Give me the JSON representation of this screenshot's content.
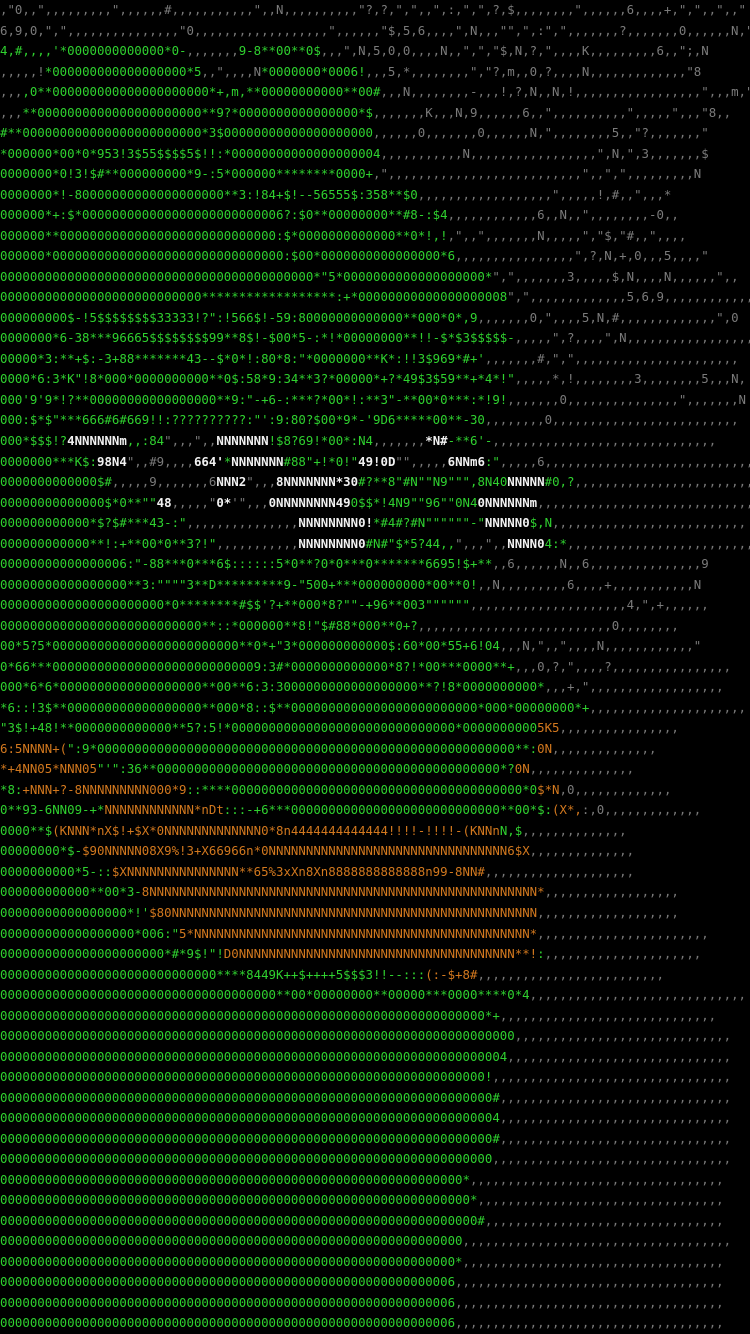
{
  "colors": {
    "background": "#000000",
    "green": "#2fd12f",
    "green_dim": "#1f8f1f",
    "gray": "#7a7a7a",
    "white": "#f2f2f2",
    "orange": "#d2781e"
  },
  "art": {
    "description_free": true,
    "lines": [
      [
        [
          "gr",
          ",\"0,,\",,,,,,,,,\",,,,,,#,,,,,,,,,,,\",,N,,,,,,,,,,\"?,?,\",\",,\",:,\",\",?,$,,,,,,,,\",,,,,,6,,,,+,\",\",,\",,\""
        ]
      ],
      [
        [
          "gr",
          "6,9,0,\",\",,,,,,,,,,,,,,,\"0,,,,,,,,,,,,,,,,,,\",,,,,,\"$,5,6,,,,\",N,,,\"\",\",:\",\",,,,,,,?,,,,,,,0,,,,,,N,\",\",\"5,,,"
        ]
      ],
      [
        [
          "g",
          "4,#,,,,"
        ],
        [
          "g",
          "'*0000000000000*0-"
        ],
        [
          "gr",
          ",,,,,,,"
        ],
        [
          "g",
          "9-8**00**0$"
        ],
        [
          "gr",
          ",,,\",N,5,0,0,,,,N,,\",\",\"$,N,?,\",,,,K,,,,,,,,,6,,\";,N"
        ]
      ],
      [
        [
          "gr",
          ",,,,,!"
        ],
        [
          "g",
          "*000000000000000000*5"
        ],
        [
          "gr",
          ",,\",,,,N"
        ],
        [
          "g",
          "*0000000*0006!"
        ],
        [
          "gr",
          ",,,5,*,,,,,,,,\",\"?,m,,0,?,,,,N,,,,,,,,,,,,,\"8"
        ]
      ],
      [
        [
          "gr",
          ",,,"
        ],
        [
          "g",
          ",0**000000000000000000000*+,m,**00000000000**00#"
        ],
        [
          "gr",
          ",,,N,,,,,,,,-,,,!,?,N,,N,!,,,,,,,,,,,,,,,,,\",,,m,\",N"
        ]
      ],
      [
        [
          "gr",
          ",,,"
        ],
        [
          "g",
          "**0000000000000000000000**9?*0000000000000000*$"
        ],
        [
          "gr",
          ",,,,,,,K,,,N,9,,,,,,6,,\",,,,,,,,,,\",,,,,\",,,\"8,,"
        ]
      ],
      [
        [
          "g",
          "#**000000000000000000000000*3$00000000000000000000"
        ],
        [
          "gr",
          ",,,,,,0,,,,,,,0,,,,,,N,\",,,,,,,,5,,\"?,,,,,,,\""
        ]
      ],
      [
        [
          "g",
          "*000000*00*0*953!3$55$$$$5$!!:*00000000000000000004"
        ],
        [
          "gr",
          ",,,,,,,,,,,N,,,,,,,,,,,,,,,,,\",N,\",3,,,,,,,$"
        ]
      ],
      [
        [
          "g",
          "0000000*0!3!$#**000000000*9-:5*000000********0000+"
        ],
        [
          "gr",
          ",\",,,,,,,,,,,,,,,,,,,,,,,,,,\",,\",\",,,,,,,,,N"
        ]
      ],
      [
        [
          "g",
          "0000000*!-80000000000000000000**3:!84+$!--56555$:358**$0"
        ],
        [
          "gr",
          ",,,,,,,,,,,,,,,,,,\",,,,,!,#,,\",,,*"
        ]
      ],
      [
        [
          "g",
          "000000*+:$*000000000000000000000000006?:$0**00000000**#8-:$4"
        ],
        [
          "gr",
          ",,,,,,,,,,,,6,,N,,\",,,,,,,,-0,,"
        ]
      ],
      [
        [
          "g",
          "000000**00000000000000000000000000000:$*0000000000000**0*!,!"
        ],
        [
          "gr",
          ",\",,\",,,,,,,N,,,,,\",\"$,\"#,,\",,,,"
        ]
      ],
      [
        [
          "g",
          "000000*0000000000000000000000000000000:$00*0000000000000000*6"
        ],
        [
          "gr",
          ",,,,,,,,,,,,,,,,\",?,N,+,0,,,5,,,,\""
        ]
      ],
      [
        [
          "g",
          "000000000000000000000000000000000000000000*\"5*0000000000000000000*"
        ],
        [
          "gr",
          "\",\",,,,,,,3,,,,,$,N,,,,N,,,,,,\",,"
        ]
      ],
      [
        [
          "g",
          "000000000000000000000000000******************:+*00000000000000000008"
        ],
        [
          "gr",
          "\",\",,,,,,,,,,,,,5,6,9,,,,,,,,,,,,"
        ]
      ],
      [
        [
          "g",
          "000000000$-!5$$$$$$$$33333!?\":!566$!-59:80000000000000**000*0*,9"
        ],
        [
          "gr",
          ",,,,,,,0,\",,,,5,N,#,,,,,,,,,,,,,\",0"
        ]
      ],
      [
        [
          "g",
          "0000000*6-38***96665$$$$$$$$99**8$!-$00*5-:*!*00000000**!!-$*$3$$$$$-"
        ],
        [
          "gr",
          ",,,,,\",?,,,,\",N,,,,,,,,,,,,,,,,,,"
        ]
      ],
      [
        [
          "g",
          "00000*3:**+$:-3+88*******43--$*0*!:80*8:\"*0000000**K*:!!3$969*#+'"
        ],
        [
          "gr",
          ",,,,,,,#,\",\",,,,,,,,,,,,,,,,,,,,,,"
        ]
      ],
      [
        [
          "g",
          "0000*6:3*K\"!8*000*0000000000**0$:58*9:34**3?*00000*+?*49$3$59**+*4*!\""
        ],
        [
          "gr",
          ",,,,,*,!,,,,,,,,3,,,,,,,,5,,,N,"
        ]
      ],
      [
        [
          "g",
          "000'9'9*!?**00000000000000000**9:\"-+6-:***?*00*!:**3\"-**00*0***:*!9!"
        ],
        [
          "gr",
          ",,,,,,,0,,,,,,,,,,,,,,,\",,,,,,,N"
        ]
      ],
      [
        [
          "g",
          "000:$*$\"***666#6#669!!:??????????:\"':9:80?$00*9*-'9D6*****00**-30"
        ],
        [
          "gr",
          ",,,,,,,,0,,,,,,,,,,,,,,,,,,,,,,,,,"
        ]
      ],
      [
        [
          "g",
          "000*$$$!?"
        ],
        [
          "w",
          "4NNNNNNm"
        ],
        [
          "g",
          ",,:84"
        ],
        [
          "gr",
          "\",,,\",,"
        ],
        [
          "w",
          "NNNNNNN"
        ],
        [
          "g",
          "!$8?69!*00*:N4"
        ],
        [
          "gr",
          ",,,,,,,"
        ],
        [
          "w",
          "*N#"
        ],
        [
          "g",
          "-**6'-"
        ],
        [
          "gr",
          ",,,,,,,,,,,,,,,,,,,,,,,,,,,,,,"
        ]
      ],
      [
        [
          "g",
          "0000000***K$:"
        ],
        [
          "w",
          "98N4"
        ],
        [
          "gr",
          "\",,#9,,,,"
        ],
        [
          "w",
          "664'"
        ],
        [
          "g",
          "*"
        ],
        [
          "w",
          "NNNNNNN"
        ],
        [
          "g",
          "#88\"+!*0!\""
        ],
        [
          "w",
          "49!0D"
        ],
        [
          "gr",
          "\"\",,,,,"
        ],
        [
          "w",
          "6NNm6"
        ],
        [
          "g",
          ":\""
        ],
        [
          "gr",
          ",,,,,6,,,,,,,,,,,,,,,,,,,,,,,,,,,,"
        ]
      ],
      [
        [
          "g",
          "0000000000000$#"
        ],
        [
          "gr",
          ",,,,,9,,,,,,,6"
        ],
        [
          "w",
          "NNN2"
        ],
        [
          "gr",
          "\",,,"
        ],
        [
          "w",
          "8NNNNNNN*30"
        ],
        [
          "g",
          "#?**8\"#N\"\"N9\"\"\",8N40"
        ],
        [
          "w",
          "NNNNN"
        ],
        [
          "g",
          "#0,?"
        ],
        [
          "gr",
          ",,,,,,,,,,,,,,,,,,,,,,,,"
        ]
      ],
      [
        [
          "g",
          "00000000000000$*0**\"\""
        ],
        [
          "w",
          "48"
        ],
        [
          "gr",
          ",,,,,\""
        ],
        [
          "w",
          "0*"
        ],
        [
          "gr",
          "'\",,,"
        ],
        [
          "w",
          "0NNNNNNNN49"
        ],
        [
          "g",
          "0$$*!4N9\"\"96\"\"0N4"
        ],
        [
          "w",
          "0NNNNNNm"
        ],
        [
          "gr",
          ",,,,,,,,,,,,,,,,,,,,,,,,,,,,,,,,"
        ]
      ],
      [
        [
          "g",
          "000000000000*$?$#***43-:\""
        ],
        [
          "gr",
          ",,,,,,,,,,,,,,,"
        ],
        [
          "w",
          "NNNNNNNN0!"
        ],
        [
          "g",
          "*#4#?#N\"\"\"\"\"\"-\""
        ],
        [
          "w",
          "NNNNN0"
        ],
        [
          "g",
          "$,N"
        ],
        [
          "gr",
          ",,,,,,,,,,,,,,,,,,,,,,,,,,"
        ]
      ],
      [
        [
          "g",
          "000000000000**!:+**00*0**3?!\""
        ],
        [
          "gr",
          ",,,,,,,,,,,"
        ],
        [
          "w",
          "NNNNNNNN0"
        ],
        [
          "g",
          "#N#\"$*5?44,,"
        ],
        [
          "gr",
          "\",,,\",,"
        ],
        [
          "w",
          "NNNN0"
        ],
        [
          "g",
          "4:*"
        ],
        [
          "gr",
          ",,,,,,,,,,,,,,,,,,,,,,,,,,,,"
        ]
      ],
      [
        [
          "g",
          "00000000000000006:\"-88***0***6$::::::5*0**?0*0***0*******6695!$+**"
        ],
        [
          "gr",
          ",,6,,,,,,N,,6,,,,,,,,,,,,,,,9"
        ]
      ],
      [
        [
          "g",
          "00000000000000000**3:\"\"\"\"3**D*********9-\"500+***000000000*00**0!"
        ],
        [
          "gr",
          ",,N,,,,,,,,,6,,,,+,,,,,,,,,,,N"
        ]
      ],
      [
        [
          "g",
          "0000000000000000000000*0********#$$'?+**000*8?\"\"-+96**003\"\"\"\"\"\""
        ],
        [
          "gr",
          ",,,,,,,,,,,,,,,,,,,,,4,\",+,,,,,,"
        ]
      ],
      [
        [
          "g",
          "000000000000000000000000000**::*000000**8!\"$#88*000**0+?"
        ],
        [
          "gr",
          ",,,,,,,,,,,,,,,,,,,,,,,,,,0,,,,,,,,"
        ]
      ],
      [
        [
          "g",
          "00*5?5*0000000000000000000000000**0*+\"3*000000000000$:60*00*55+6!04"
        ],
        [
          "gr",
          ",,,N,\",,\",,,,N,,,,,,,,,,,,\""
        ]
      ],
      [
        [
          "g",
          "0*66***0000000000000000000000000009:3#*0000000000000*8?!*00***0000**+"
        ],
        [
          "gr",
          ",,,0,?,\",,,,?,,,,,,,,,,,,,,,,"
        ]
      ],
      [
        [
          "g",
          "000*6*6*0000000000000000000**00**6:3:3000000000000000000**?!8*0000000000*"
        ],
        [
          "gr",
          ",,,+,\",,,,,,,,,,,,,,,,,,"
        ]
      ],
      [
        [
          "g",
          "*6::!3$**000000000000000000**000*8::$**0000000000000000000000000*000*00000000*+"
        ],
        [
          "gr",
          ",,,,,,,,,,,,,,,,,,,,,"
        ]
      ],
      [
        [
          "g",
          "\"3$!+48!**0000000000000**5?:5!*000000000000000000000000000000*0000000000"
        ],
        [
          "o",
          "5K5"
        ],
        [
          "gr",
          ",,,,,,,,,,,,,,,,"
        ]
      ],
      [
        [
          "o",
          "6:5NNNN+("
        ],
        [
          "g",
          "\":9*00000000000000000000000000000000000000000000000000000000**:"
        ],
        [
          "o",
          "0N"
        ],
        [
          "gr",
          ",,,,,,,,,,,,,,"
        ]
      ],
      [
        [
          "o",
          "*+4NN05*NNN05"
        ],
        [
          "g",
          "\"'\":36**0000000000000000000000000000000000000000000000*?"
        ],
        [
          "o",
          "0N"
        ],
        [
          "gr",
          ",,,,,,,,,,,,,,"
        ]
      ],
      [
        [
          "g",
          "*8:"
        ],
        [
          "o",
          "+NNN+?-8NNNNNNNNN000*9"
        ],
        [
          "g",
          "::****000000000000000000000000000000000000000*0"
        ],
        [
          "o",
          "$*N"
        ],
        [
          "gr",
          ",0,,,,,,,,,,,,,"
        ]
      ],
      [
        [
          "g",
          "0**93-6NN09-+*"
        ],
        [
          "o",
          "NNNNNNNNNNNN*nDt"
        ],
        [
          "g",
          ":::-+6***0000000000000000000000000000**00*$:"
        ],
        [
          "o",
          "(X*,"
        ],
        [
          "gr",
          ":,0,,,,,,,,,,,,,"
        ]
      ],
      [
        [
          "g",
          "0000**$"
        ],
        [
          "o",
          "(KNNN*nX$!+$X*0NNNNNNNNNNNNN0*8n4444444444444!!!!-!!!!-(KNNn"
        ],
        [
          "g",
          "N,$"
        ],
        [
          "gr",
          ",,,,,,,,,,,,,,"
        ]
      ],
      [
        [
          "g",
          "00000000*$-"
        ],
        [
          "o",
          "$90NNNNN08X9%!3+X66966n*0NNNNNNNNNNNNNNNNNNNNNNNNNNNNNNNN6$X"
        ],
        [
          "gr",
          ",,,,,,,,,,,,,,"
        ]
      ],
      [
        [
          "g",
          "0000000000*5-::"
        ],
        [
          "o",
          "$XNNNNNNNNNNNNNNN**65%3xXn8Xn8888888888888n99-8NN#"
        ],
        [
          "gr",
          ",,,,,,,,,,,,,,,,,,,,"
        ]
      ],
      [
        [
          "g",
          "000000000000**00*3-"
        ],
        [
          "o",
          "8NNNNNNNNNNNNNNNNNNNNNNNNNNNNNNNNNNNNNNNNNNNNNNNNNNNN*"
        ],
        [
          "gr",
          ",,,,,,,,,,,,,,,,,,"
        ]
      ],
      [
        [
          "g",
          "00000000000000000*!'"
        ],
        [
          "o",
          "$80NNNNNNNNNNNNNNNNNNNNNNNNNNNNNNNNNNNNNNNNNNNNNNNNN"
        ],
        [
          "gr",
          ",,,,,,,,,,,,,,,,,,,"
        ]
      ],
      [
        [
          "g",
          "000000000000000000*006:\""
        ],
        [
          "o",
          "5*NNNNNNNNNNNNNNNNNNNNNNNNNNNNNNNNNNNNNNNNNNNNN*"
        ],
        [
          "gr",
          ",,,,,,,,,,,,,,,,,,,,,,,"
        ]
      ],
      [
        [
          "g",
          "0000000000000000000000*#*9$!\"!"
        ],
        [
          "o",
          "D0NNNNNNNNNNNNNNNNNNNNNNNNNNNNNNNNNNNNN**!"
        ],
        [
          "g",
          ":"
        ],
        [
          "gr",
          ",,,,,,,,,,,,,,,,,,,,,"
        ]
      ],
      [
        [
          "g",
          "00000000000000000000000000000****8449K++$++++5$$$3!!--:::"
        ],
        [
          "o",
          "(:-$+8#"
        ],
        [
          "gr",
          ",,,,,,,,,,,,,,,,,,,,,,,,,"
        ]
      ],
      [
        [
          "g",
          "0000000000000000000000000000000000000**00*00000000**00000***0000****0*4"
        ],
        [
          "gr",
          ",,,,,,,,,,,,,,,,,,,,,,,,,,,,,"
        ]
      ],
      [
        [
          "g",
          "00000000000000000000000000000000000000000000000000000000000000000*+"
        ],
        [
          "gr",
          ",,,,,,,,,,,,,,,,,,,,,,,,,,,,,"
        ]
      ],
      [
        [
          "g",
          "000000000000000000000000000000000000000000000000000000000000000000000"
        ],
        [
          "gr",
          ",,,,,,,,,,,,,,,,,,,,,,,,,,,,,"
        ]
      ],
      [
        [
          "g",
          "00000000000000000000000000000000000000000000000000000000000000000004"
        ],
        [
          "gr",
          ",,,,,,,,,,,,,,,,,,,,,,,,,,,,,,"
        ]
      ],
      [
        [
          "g",
          "00000000000000000000000000000000000000000000000000000000000000000!"
        ],
        [
          "gr",
          ",,,,,,,,,,,,,,,,,,,,,,,,,,,,,,,,"
        ]
      ],
      [
        [
          "g",
          "000000000000000000000000000000000000000000000000000000000000000000#"
        ],
        [
          "gr",
          ",,,,,,,,,,,,,,,,,,,,,,,,,,,,,,,"
        ]
      ],
      [
        [
          "g",
          "0000000000000000000000000000000000000000000000000000000000000000004"
        ],
        [
          "gr",
          ",,,,,,,,,,,,,,,,,,,,,,,,,,,,,,,"
        ]
      ],
      [
        [
          "g",
          "000000000000000000000000000000000000000000000000000000000000000000#"
        ],
        [
          "gr",
          ",,,,,,,,,,,,,,,,,,,,,,,,,,,,,,,"
        ]
      ],
      [
        [
          "g",
          "000000000000000000000000000000000000000000000000000000000000000000"
        ],
        [
          "gr",
          ",,,,,,,,,,,,,,,,,,,,,,,,,,,,,,,,"
        ]
      ],
      [
        [
          "g",
          "00000000000000000000000000000000000000000000000000000000000000*"
        ],
        [
          "gr",
          ",,,,,,,,,,,,,,,,,,,,,,,,,,,,,,,,,,"
        ]
      ],
      [
        [
          "g",
          "000000000000000000000000000000000000000000000000000000000000000*"
        ],
        [
          "gr",
          ",,,,,,,,,,,,,,,,,,,,,,,,,,,,,,,,,"
        ]
      ],
      [
        [
          "g",
          "0000000000000000000000000000000000000000000000000000000000000000#"
        ],
        [
          "gr",
          ",,,,,,,,,,,,,,,,,,,,,,,,,,,,,,,,"
        ]
      ],
      [
        [
          "g",
          "00000000000000000000000000000000000000000000000000000000000000"
        ],
        [
          "gr",
          ",,,,,,,,,,,,,,,,,,,,,,,,,,,,,,,,,,,,"
        ]
      ],
      [
        [
          "g",
          "0000000000000000000000000000000000000000000000000000000000000*"
        ],
        [
          "gr",
          ",,,,,,,,,,,,,,,,,,,,,,,,,,,,,,,,,,,"
        ]
      ],
      [
        [
          "g",
          "0000000000000000000000000000000000000000000000000000000000006"
        ],
        [
          "gr",
          ",,,,,,,,,,,,,,,,,,,,,,,,,,,,,,,,,,,,"
        ]
      ],
      [
        [
          "g",
          "0000000000000000000000000000000000000000000000000000000000006"
        ],
        [
          "gr",
          ",,,,,,,,,,,,,,,,,,,,,,,,,,,,,,,,,,,,"
        ]
      ],
      [
        [
          "g",
          "0000000000000000000000000000000000000000000000000000000000006"
        ],
        [
          "gr",
          ",,,,,,,,,,,,,,,,,,,,,,,,,,,,,,,,,,,,"
        ]
      ]
    ]
  }
}
